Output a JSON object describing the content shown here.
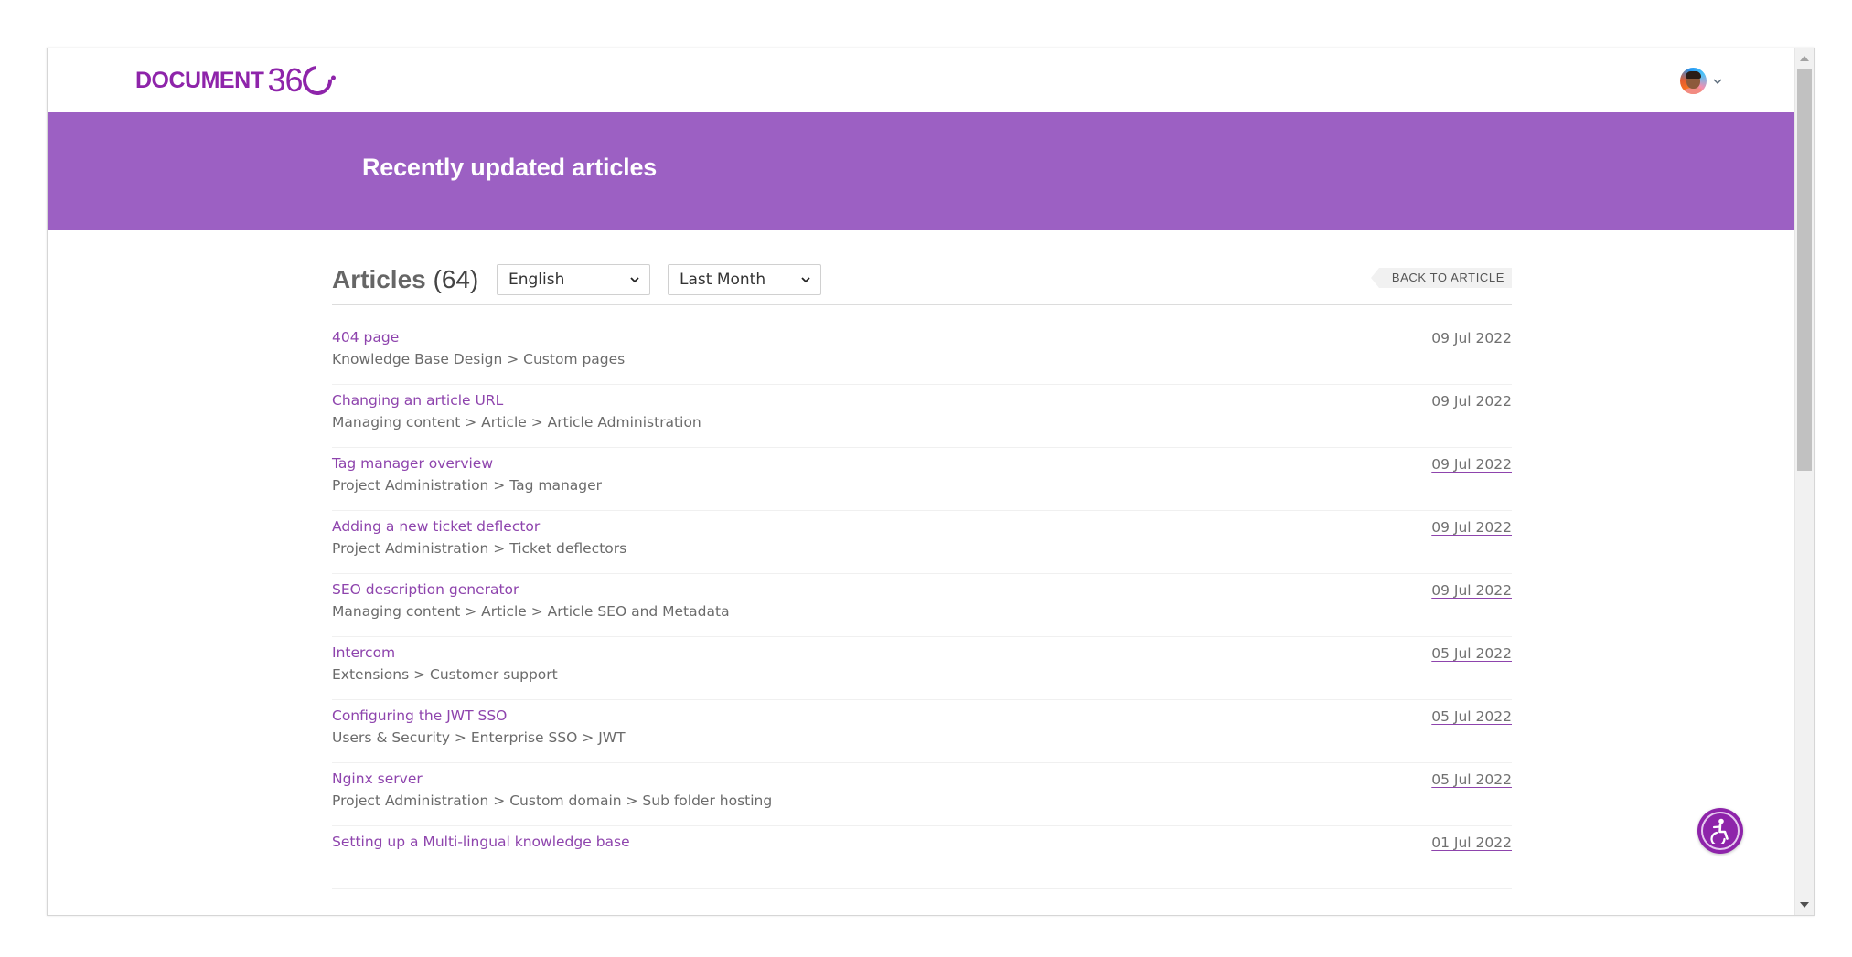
{
  "header": {
    "logo_word": "DOCUMENT",
    "logo_number": "36",
    "user_avatar_icon": "user-avatar",
    "user_menu_icon": "chevron-down-icon"
  },
  "banner": {
    "title": "Recently updated articles",
    "background_color": "#9c60c3"
  },
  "toolbar": {
    "title": "Articles",
    "count": "(64)",
    "language_select": {
      "selected": "English"
    },
    "range_select": {
      "selected": "Last Month"
    },
    "back_button": "BACK TO ARTICLE"
  },
  "articles": [
    {
      "title": "404 page",
      "path": "Knowledge Base Design > Custom pages",
      "date": "09 Jul 2022"
    },
    {
      "title": "Changing an article URL",
      "path": "Managing content > Article > Article Administration",
      "date": "09 Jul 2022"
    },
    {
      "title": "Tag manager overview",
      "path": "Project Administration > Tag manager",
      "date": "09 Jul 2022"
    },
    {
      "title": "Adding a new ticket deflector",
      "path": "Project Administration > Ticket deflectors",
      "date": "09 Jul 2022"
    },
    {
      "title": "SEO description generator",
      "path": "Managing content > Article > Article SEO and Metadata",
      "date": "09 Jul 2022"
    },
    {
      "title": "Intercom",
      "path": "Extensions > Customer support",
      "date": "05 Jul 2022"
    },
    {
      "title": "Configuring the JWT SSO",
      "path": "Users & Security > Enterprise SSO > JWT",
      "date": "05 Jul 2022"
    },
    {
      "title": "Nginx server",
      "path": "Project Administration > Custom domain > Sub folder hosting",
      "date": "05 Jul 2022"
    },
    {
      "title": "Setting up a Multi-lingual knowledge base",
      "path": "",
      "date": "01 Jul 2022"
    }
  ],
  "accessibility": {
    "icon": "accessibility-icon"
  },
  "colors": {
    "brand": "#8e24aa",
    "link": "#8e44ad",
    "banner": "#9c60c3"
  }
}
